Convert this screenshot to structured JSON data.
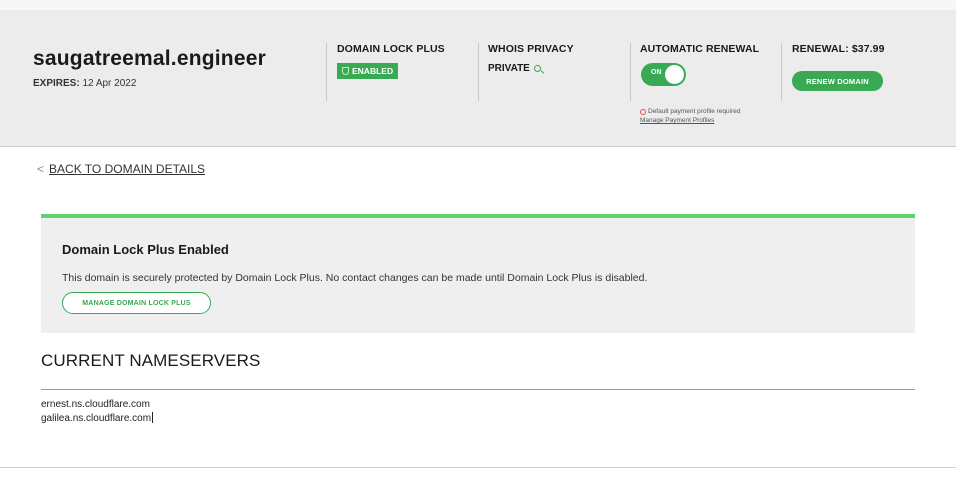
{
  "header": {
    "domain": "saugatreemal.engineer",
    "expires_label": "EXPIRES:",
    "expires_value": "12 Apr 2022",
    "lock": {
      "title": "DOMAIN LOCK PLUS",
      "status": "ENABLED"
    },
    "whois": {
      "title": "WHOIS PRIVACY",
      "value": "PRIVATE"
    },
    "renewal": {
      "title": "AUTOMATIC RENEWAL",
      "toggle_label": "ON",
      "note": "Default payment profile required",
      "link": "Manage Payment Profiles"
    },
    "renew": {
      "title": "RENEWAL: $37.99",
      "button": "RENEW DOMAIN"
    }
  },
  "nav": {
    "back_label": "BACK TO DOMAIN DETAILS"
  },
  "notice": {
    "title": "Domain Lock Plus Enabled",
    "text": "This domain is securely protected by Domain Lock Plus. No contact changes can be made until Domain Lock Plus is disabled.",
    "button": "MANAGE DOMAIN LOCK PLUS"
  },
  "nameservers": {
    "title": "CURRENT NAMESERVERS",
    "items": [
      "ernest.ns.cloudflare.com",
      "galilea.ns.cloudflare.com"
    ]
  },
  "colors": {
    "accent": "#3aa953",
    "notice_bar": "#5cd36e",
    "header_bg": "#ececec"
  },
  "icons": [
    "shield-icon",
    "search-icon",
    "warning-icon",
    "chevron-left-icon"
  ]
}
